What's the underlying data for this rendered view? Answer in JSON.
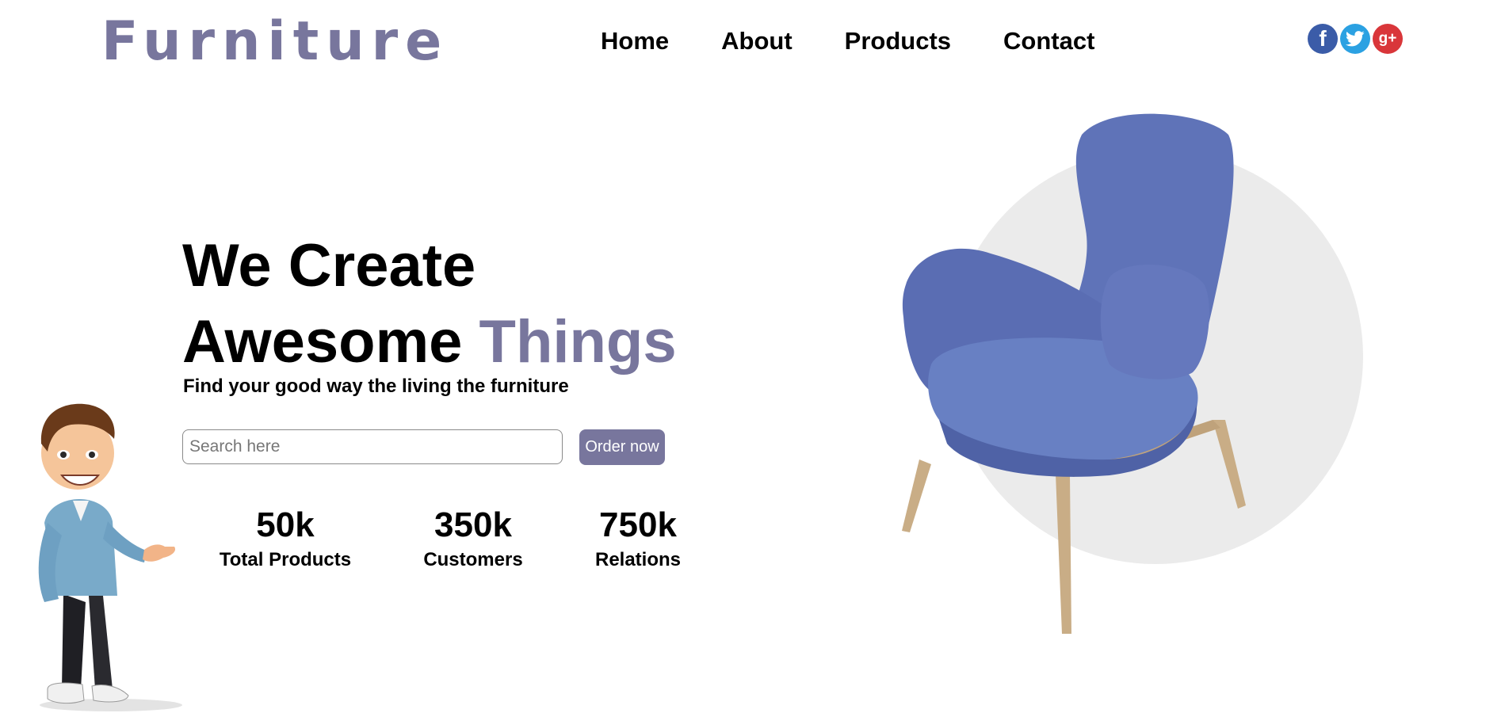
{
  "header": {
    "brand": "Furniture",
    "nav": [
      "Home",
      "About",
      "Products",
      "Contact"
    ],
    "social": {
      "facebook_glyph": "f",
      "google_glyph": "g+",
      "icons": [
        "facebook-icon",
        "twitter-icon",
        "google-plus-icon"
      ]
    }
  },
  "hero": {
    "title_line1": "We Create",
    "title_line2_plain": "Awesome ",
    "title_line2_accent": "Things",
    "tagline": "Find your good way the living the furniture",
    "search_placeholder": "Search here",
    "order_label": "Order now"
  },
  "stats": [
    {
      "value": "50k",
      "label": "Total Products"
    },
    {
      "value": "350k",
      "label": "Customers"
    },
    {
      "value": "750k",
      "label": "Relations"
    }
  ],
  "colors": {
    "accent": "#78769d",
    "chair": "#5a6fb5",
    "backdrop_circle": "#ebebeb",
    "facebook": "#3b5ca8",
    "twitter": "#2ba1e2",
    "google_plus": "#d9363a"
  },
  "images": [
    "blue-armchair",
    "cartoon-man-presenting"
  ]
}
